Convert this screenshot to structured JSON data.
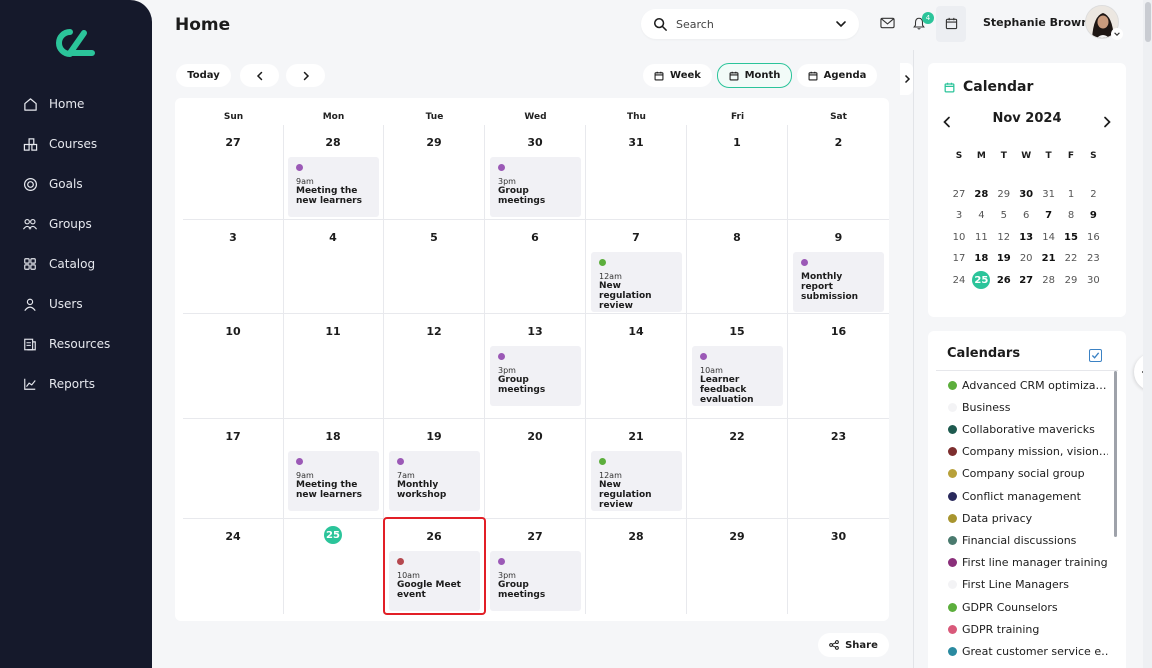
{
  "page": {
    "title": "Home"
  },
  "colors": {
    "accent": "#2bc49a",
    "sidebar_bg": "#15192b",
    "selected_border": "#e21f26"
  },
  "sidebar": {
    "items": [
      {
        "label": "Home",
        "icon": "home-icon"
      },
      {
        "label": "Courses",
        "icon": "courses-icon"
      },
      {
        "label": "Goals",
        "icon": "goals-icon"
      },
      {
        "label": "Groups",
        "icon": "groups-icon"
      },
      {
        "label": "Catalog",
        "icon": "catalog-icon"
      },
      {
        "label": "Users",
        "icon": "user-icon"
      },
      {
        "label": "Resources",
        "icon": "resources-icon"
      },
      {
        "label": "Reports",
        "icon": "reports-icon"
      }
    ]
  },
  "header": {
    "search_placeholder": "Search",
    "notification_count": "4",
    "user_name": "Stephanie Brown"
  },
  "toolbar": {
    "today_label": "Today",
    "views": [
      {
        "label": "Week",
        "active": false
      },
      {
        "label": "Month",
        "active": true
      },
      {
        "label": "Agenda",
        "active": false
      }
    ]
  },
  "calendar": {
    "weekdays": [
      "Sun",
      "Mon",
      "Tue",
      "Wed",
      "Thu",
      "Fri",
      "Sat"
    ],
    "weeks": [
      [
        {
          "day": "27"
        },
        {
          "day": "28",
          "event": {
            "time": "9am",
            "title": "Meeting the new learners",
            "color": "#9b59b6"
          }
        },
        {
          "day": "29"
        },
        {
          "day": "30",
          "event": {
            "time": "3pm",
            "title": "Group meetings",
            "color": "#9b59b6"
          }
        },
        {
          "day": "31"
        },
        {
          "day": "1"
        },
        {
          "day": "2"
        }
      ],
      [
        {
          "day": "3"
        },
        {
          "day": "4"
        },
        {
          "day": "5"
        },
        {
          "day": "6"
        },
        {
          "day": "7",
          "event": {
            "time": "12am",
            "title": "New regulation review",
            "color": "#5cae3c"
          }
        },
        {
          "day": "8"
        },
        {
          "day": "9",
          "event": {
            "time": "",
            "title": "Monthly report submission",
            "color": "#9b59b6"
          }
        }
      ],
      [
        {
          "day": "10"
        },
        {
          "day": "11"
        },
        {
          "day": "12"
        },
        {
          "day": "13",
          "event": {
            "time": "3pm",
            "title": "Group meetings",
            "color": "#9b59b6"
          }
        },
        {
          "day": "14"
        },
        {
          "day": "15",
          "event": {
            "time": "10am",
            "title": "Learner feedback evaluation",
            "color": "#9b59b6"
          }
        },
        {
          "day": "16"
        }
      ],
      [
        {
          "day": "17"
        },
        {
          "day": "18",
          "event": {
            "time": "9am",
            "title": "Meeting the new learners",
            "color": "#9b59b6"
          }
        },
        {
          "day": "19",
          "event": {
            "time": "7am",
            "title": "Monthly workshop",
            "color": "#9b59b6"
          }
        },
        {
          "day": "20"
        },
        {
          "day": "21",
          "event": {
            "time": "12am",
            "title": "New regulation review",
            "color": "#5cae3c"
          }
        },
        {
          "day": "22"
        },
        {
          "day": "23"
        }
      ],
      [
        {
          "day": "24"
        },
        {
          "day": "25",
          "today": true
        },
        {
          "day": "26",
          "selected": true,
          "event": {
            "time": "10am",
            "title": "Google Meet event",
            "color": "#b5484f"
          }
        },
        {
          "day": "27",
          "event": {
            "time": "3pm",
            "title": "Group meetings",
            "color": "#9b59b6"
          }
        },
        {
          "day": "28"
        },
        {
          "day": "29"
        },
        {
          "day": "30"
        }
      ]
    ]
  },
  "share_label": "Share",
  "mini_calendar": {
    "title": "Calendar",
    "month_label": "Nov 2024",
    "weekdays": [
      "S",
      "M",
      "T",
      "W",
      "T",
      "F",
      "S"
    ],
    "weeks": [
      [
        {
          "d": "27"
        },
        {
          "d": "28",
          "b": true
        },
        {
          "d": "29"
        },
        {
          "d": "30",
          "b": true
        },
        {
          "d": "31"
        },
        {
          "d": "1"
        },
        {
          "d": "2"
        }
      ],
      [
        {
          "d": "3"
        },
        {
          "d": "4"
        },
        {
          "d": "5"
        },
        {
          "d": "6"
        },
        {
          "d": "7",
          "b": true
        },
        {
          "d": "8"
        },
        {
          "d": "9",
          "b": true
        }
      ],
      [
        {
          "d": "10"
        },
        {
          "d": "11"
        },
        {
          "d": "12"
        },
        {
          "d": "13",
          "b": true
        },
        {
          "d": "14"
        },
        {
          "d": "15",
          "b": true
        },
        {
          "d": "16"
        }
      ],
      [
        {
          "d": "17"
        },
        {
          "d": "18",
          "b": true
        },
        {
          "d": "19",
          "b": true
        },
        {
          "d": "20"
        },
        {
          "d": "21",
          "b": true
        },
        {
          "d": "22"
        },
        {
          "d": "23"
        }
      ],
      [
        {
          "d": "24"
        },
        {
          "d": "25",
          "t": true
        },
        {
          "d": "26",
          "b": true
        },
        {
          "d": "27",
          "b": true
        },
        {
          "d": "28"
        },
        {
          "d": "29"
        },
        {
          "d": "30"
        }
      ]
    ]
  },
  "calendars": {
    "title": "Calendars",
    "items": [
      {
        "label": "Advanced CRM optimiza…",
        "color": "#5cae3c"
      },
      {
        "label": "Business",
        "color": "#f3f3f5"
      },
      {
        "label": "Collaborative mavericks",
        "color": "#1e5a4f"
      },
      {
        "label": "Company mission, vision…",
        "color": "#7d2e2e"
      },
      {
        "label": "Company social group",
        "color": "#b8a13a"
      },
      {
        "label": "Conflict management",
        "color": "#2a2a5c"
      },
      {
        "label": "Data privacy",
        "color": "#a8952f"
      },
      {
        "label": "Financial discussions",
        "color": "#4a7a6e"
      },
      {
        "label": "First line manager training",
        "color": "#8a2f7a"
      },
      {
        "label": "First Line Managers",
        "color": "#f3f3f5"
      },
      {
        "label": "GDPR Counselors",
        "color": "#5cae3c"
      },
      {
        "label": "GDPR training",
        "color": "#d9597a"
      },
      {
        "label": "Great customer service e…",
        "color": "#2a8aa0"
      }
    ]
  }
}
